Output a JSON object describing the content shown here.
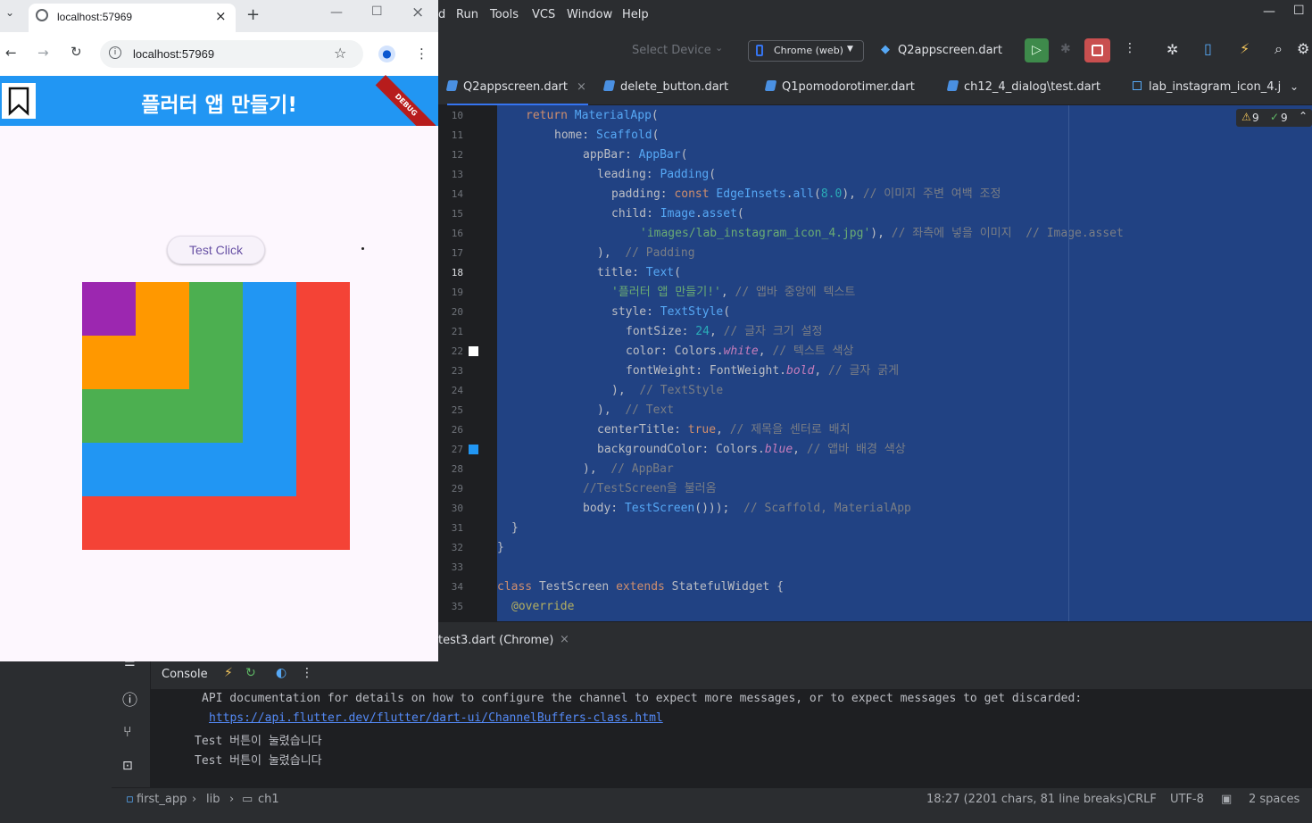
{
  "browser": {
    "tab_title": "localhost:57969",
    "url": "localhost:57969",
    "app_title": "플러터 앱 만들기!",
    "debug_banner": "DEBUG",
    "button_label": "Test Click",
    "boxes": [
      {
        "name": "red",
        "color": "#f44336"
      },
      {
        "name": "blue",
        "color": "#2196f3"
      },
      {
        "name": "green",
        "color": "#4caf50"
      },
      {
        "name": "orange",
        "color": "#ff9800"
      },
      {
        "name": "purple",
        "color": "#9c27b0"
      }
    ]
  },
  "ide": {
    "menu": [
      "d",
      "Run",
      "Tools",
      "VCS",
      "Window",
      "Help"
    ],
    "select_device": "Select Device",
    "device": "Chrome (web)",
    "run_config": "Q2appscreen.dart",
    "tabs": [
      "Q2appscreen.dart",
      "delete_button.dart",
      "Q1pomodorotimer.dart",
      "ch12_4_dialog\\test.dart",
      "lab_instagram_icon_4.j"
    ],
    "inspections": {
      "warnings": "9",
      "ok": "9"
    },
    "line_numbers": [
      "10",
      "11",
      "12",
      "13",
      "14",
      "15",
      "16",
      "17",
      "18",
      "19",
      "20",
      "21",
      "22",
      "23",
      "24",
      "25",
      "26",
      "27",
      "28",
      "29",
      "30",
      "31",
      "32",
      "33",
      "34",
      "35"
    ],
    "run_tab": "test3.dart (Chrome)",
    "console_label": "Console",
    "console_lines": [
      "API documentation for details on how to configure the channel to expect more messages, or to expect messages to get discarded:",
      "https://api.flutter.dev/flutter/dart-ui/ChannelBuffers-class.html",
      "Test 버튼이 눌렸습니다",
      "Test 버튼이 눌렸습니다"
    ],
    "breadcrumb": [
      "first_app",
      "lib",
      "ch1"
    ],
    "status": {
      "position": "18:27 (2201 chars, 81 line breaks)",
      "line_sep": "CRLF",
      "encoding": "UTF-8",
      "indent": "2 spaces"
    }
  },
  "colors": {
    "ide_bg": "#2b2d30",
    "editor_bg": "#1e1f22",
    "selection": "#214283",
    "flutter_blue": "#2196f3"
  }
}
